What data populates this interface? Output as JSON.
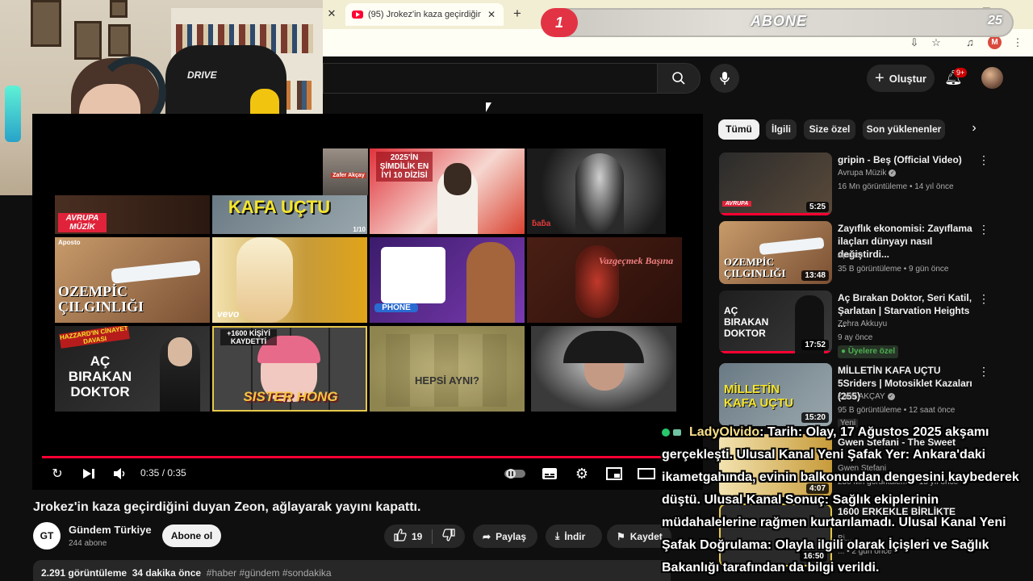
{
  "browser": {
    "tab_title": "(95) Jrokez'in kaza geçirdiğini d",
    "close_glyph": "✕",
    "new_tab_glyph": "+",
    "profile_letter": "M"
  },
  "overlay": {
    "subscribe_badge_number": "1",
    "subscribe_text": "ABONE",
    "subscribe_count": "25"
  },
  "header": {
    "create_label": "Oluştur",
    "notif_badge": "9+"
  },
  "player": {
    "time": "0:35 / 0:35",
    "endscreen": [
      {
        "label": "AVRUPA MÜZİK",
        "channel": ""
      },
      {
        "label": "KAFA UÇTU",
        "corner": "1/10"
      },
      {
        "label": "2025'İN ŞİMDİLİK EN İYİ 10 DİZİSİ"
      },
      {
        "label": "OZEMPİC ÇILGINLIĞI",
        "channel": "Aposto"
      },
      {
        "label": "vevo"
      },
      {
        "label": "PHONE"
      },
      {
        "label": "Vazgeçmek Başına"
      },
      {
        "label": "AÇ BIRAKAN DOKTOR",
        "channel": "HAZZARD'IN CİNAYET DAVASI"
      },
      {
        "label": "SISTER HONG",
        "channel": "+1600 KİŞİYİ KAYDETTİ"
      },
      {
        "label": "HEPSİ AYNI?"
      },
      {
        "label": ""
      }
    ],
    "tiny_name": "Zafer Akçay"
  },
  "video": {
    "title": "Jrokez'in kaza geçirdiğini duyan Zeon, ağlayarak yayını kapattı.",
    "channel_initials": "GT",
    "channel_name": "Gündem Türkiye",
    "subscribers": "244 abone",
    "subscribe_label": "Abone ol",
    "likes": "19",
    "share_label": "Paylaş",
    "download_label": "İndir",
    "save_label": "Kaydet",
    "views": "2.291 görüntüleme",
    "time_ago": "34 dakika önce",
    "hashtags": "#haber #gündem #sondakika"
  },
  "sidebar": {
    "chips": [
      "Tümü",
      "İlgili",
      "Size özel",
      "Son yüklenenler"
    ],
    "recs": [
      {
        "title": "gripin - Beş (Official Video)",
        "channel": "Avrupa Müzik",
        "verified": true,
        "meta": "16 Mn görüntüleme • 14 yıl önce",
        "duration": "5:25"
      },
      {
        "title": "Zayıflık ekonomisi: Zayıflama ilaçları dünyayı nasıl değiştirdi...",
        "channel": "Aposto",
        "verified": false,
        "meta": "35 B görüntüleme • 9 gün önce",
        "duration": "13:48"
      },
      {
        "title": "Aç Bırakan Doktor, Seri Katil, Şarlatan | Starvation Heights ...",
        "channel": "Zehra Akkuyu",
        "verified": false,
        "meta": "9 ay önce",
        "duration": "17:52",
        "badge": "Üyelere özel"
      },
      {
        "title": "MİLLETİN KAFA UÇTU 5Sriders | Motosiklet Kazaları (255)",
        "channel": "Zafer AKÇAY",
        "verified": true,
        "meta": "95 B görüntüleme • 12 saat önce",
        "duration": "15:20",
        "extra": "Yeni"
      },
      {
        "title": "Gwen Stefani - The Sweet",
        "channel": "Gwen Stefani",
        "meta": "230 Mn görüntüleme • 15 yıl önce",
        "duration": "4:07"
      },
      {
        "title": "1600 ERKEKLE BİRLİKTE OLUP",
        "channel": "Bi...",
        "meta": "... • 2 gün önce",
        "duration": "16:50"
      }
    ]
  },
  "chat": {
    "user": "LadyOlvido",
    "message": ": Tarih: Olay, 17 Ağustos 2025 akşamı gerçekleşti. Ulusal Kanal Yeni Şafak Yer: Ankara'daki ikametgahında, evinin balkonundan dengesini kaybederek düştü. Ulusal Kanal Sonuç: Sağlık ekiplerinin müdahalelerine rağmen kurtarılamadı. Ulusal Kanal Yeni Şafak Doğrulama: Olayla ilgili olarak İçişleri ve Sağlık Bakanlığı tarafından da bilgi verildi."
  },
  "colors": {
    "bg": "#0f0f0f",
    "accent_red": "#ff0033",
    "tab_bar": "#f2eed3",
    "chat_user": "#f7e08a"
  }
}
